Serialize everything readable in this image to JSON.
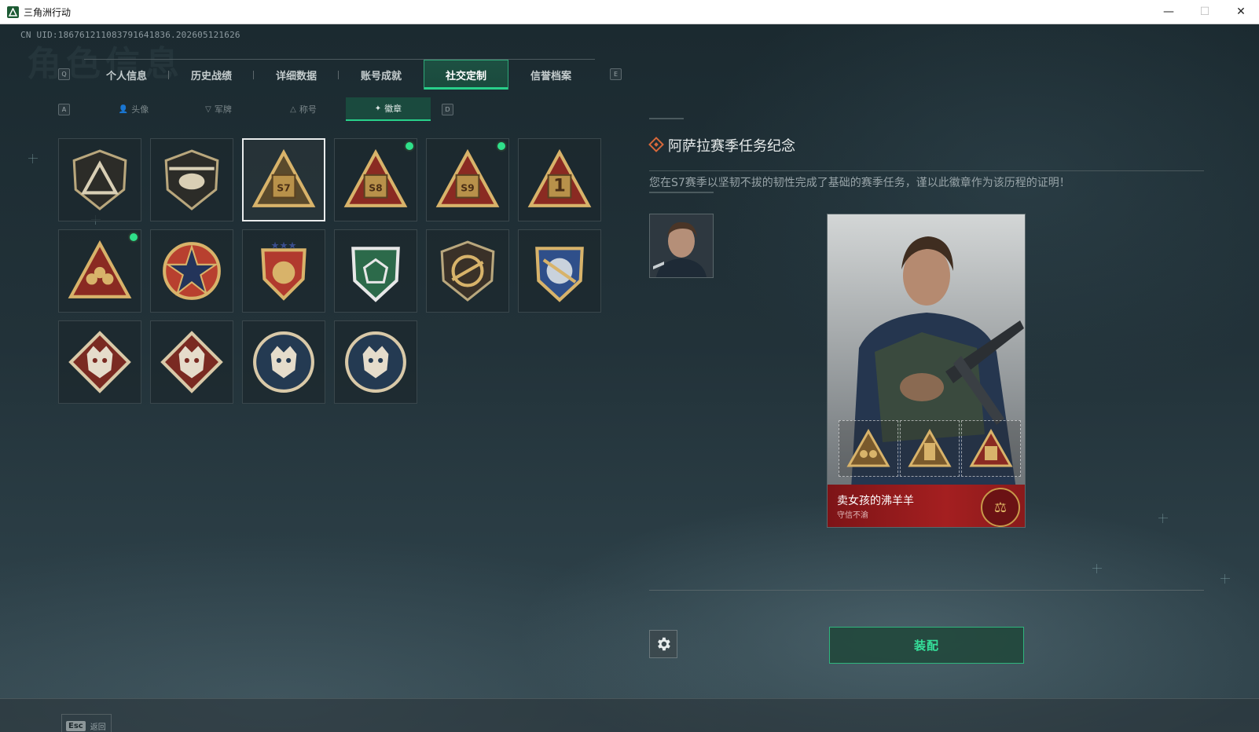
{
  "window": {
    "title": "三角洲行动",
    "min": "—",
    "max": "☐",
    "close": "✕"
  },
  "uid": "CN UID:1867612110837916418З6.202605121626",
  "ghost_title": "角色信息",
  "tabs": [
    {
      "label": "个人信息"
    },
    {
      "label": "历史战绩"
    },
    {
      "label": "详细数据"
    },
    {
      "label": "账号成就"
    },
    {
      "label": "社交定制",
      "active": true
    },
    {
      "label": "信誉档案"
    }
  ],
  "tab_keys": {
    "left": "Q",
    "right": "E"
  },
  "subtabs": [
    {
      "label": "头像",
      "icon": "person-icon"
    },
    {
      "label": "军牌",
      "icon": "dogtag-icon"
    },
    {
      "label": "称号",
      "icon": "title-icon"
    },
    {
      "label": "徽章",
      "icon": "badge-icon",
      "active": true
    }
  ],
  "subtab_keys": {
    "left": "A",
    "right": "D"
  },
  "badges": [
    {
      "name": "shield-triangle-badge",
      "notify": false
    },
    {
      "name": "helicopter-badge",
      "notify": false
    },
    {
      "name": "s7-season-badge",
      "label": "S7",
      "selected": true,
      "notify": false
    },
    {
      "name": "s8-season-badge",
      "label": "S8",
      "notify": true
    },
    {
      "name": "s9-season-badge",
      "label": "S9",
      "notify": true
    },
    {
      "name": "number-one-badge",
      "label": "1",
      "notify": false
    },
    {
      "name": "squad-triangle-badge",
      "notify": true
    },
    {
      "name": "skull-star-badge",
      "notify": false
    },
    {
      "name": "three-star-shield-badge",
      "notify": false
    },
    {
      "name": "green-gem-shield-badge",
      "notify": false
    },
    {
      "name": "rifle-shield-badge",
      "notify": false
    },
    {
      "name": "crossed-arms-badge",
      "notify": false
    },
    {
      "name": "wolf-diamond-badge-1",
      "notify": false
    },
    {
      "name": "wolf-diamond-badge-2",
      "notify": false
    },
    {
      "name": "wolf-circle-badge-1",
      "notify": false
    },
    {
      "name": "wolf-circle-badge-2",
      "notify": false
    }
  ],
  "detail": {
    "title": "阿萨拉赛季任务纪念",
    "description": "您在S7赛季以坚韧不拔的韧性完成了基础的赛季任务，谨以此徽章作为该历程的证明！"
  },
  "card": {
    "player_name": "卖女孩的沸羊羊",
    "subtitle": "守信不渝"
  },
  "equip_label": "装配",
  "footer": {
    "key": "Esc",
    "label": "返回"
  },
  "colors": {
    "accent": "#28d08a",
    "card_red": "#a41f20",
    "gold": "#d8b36a"
  }
}
